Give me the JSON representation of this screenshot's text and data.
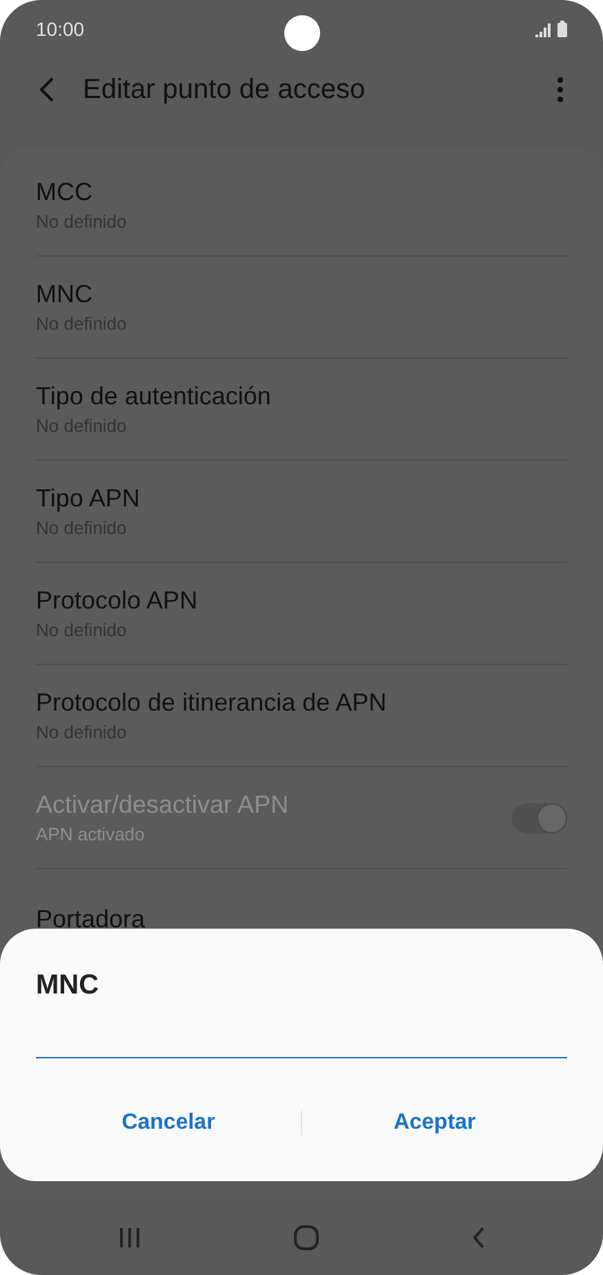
{
  "status_bar": {
    "time": "10:00"
  },
  "header": {
    "title": "Editar punto de acceso"
  },
  "items": [
    {
      "kind": "plain",
      "title": "MCC",
      "subtitle": "No definido",
      "disabled": false
    },
    {
      "kind": "plain",
      "title": "MNC",
      "subtitle": "No definido",
      "disabled": false
    },
    {
      "kind": "plain",
      "title": "Tipo de autenticación",
      "subtitle": "No definido",
      "disabled": false
    },
    {
      "kind": "plain",
      "title": "Tipo APN",
      "subtitle": "No definido",
      "disabled": false
    },
    {
      "kind": "plain",
      "title": "Protocolo APN",
      "subtitle": "No definido",
      "disabled": false
    },
    {
      "kind": "plain",
      "title": "Protocolo de itinerancia de APN",
      "subtitle": "No definido",
      "disabled": false
    },
    {
      "kind": "switch",
      "title": "Activar/desactivar APN",
      "subtitle": "APN activado",
      "disabled": true,
      "on": true
    },
    {
      "kind": "plain",
      "title": "Portadora",
      "disabled": false
    }
  ],
  "dialog": {
    "title": "MNC",
    "buttons": [
      "Cancelar",
      "Aceptar"
    ]
  }
}
